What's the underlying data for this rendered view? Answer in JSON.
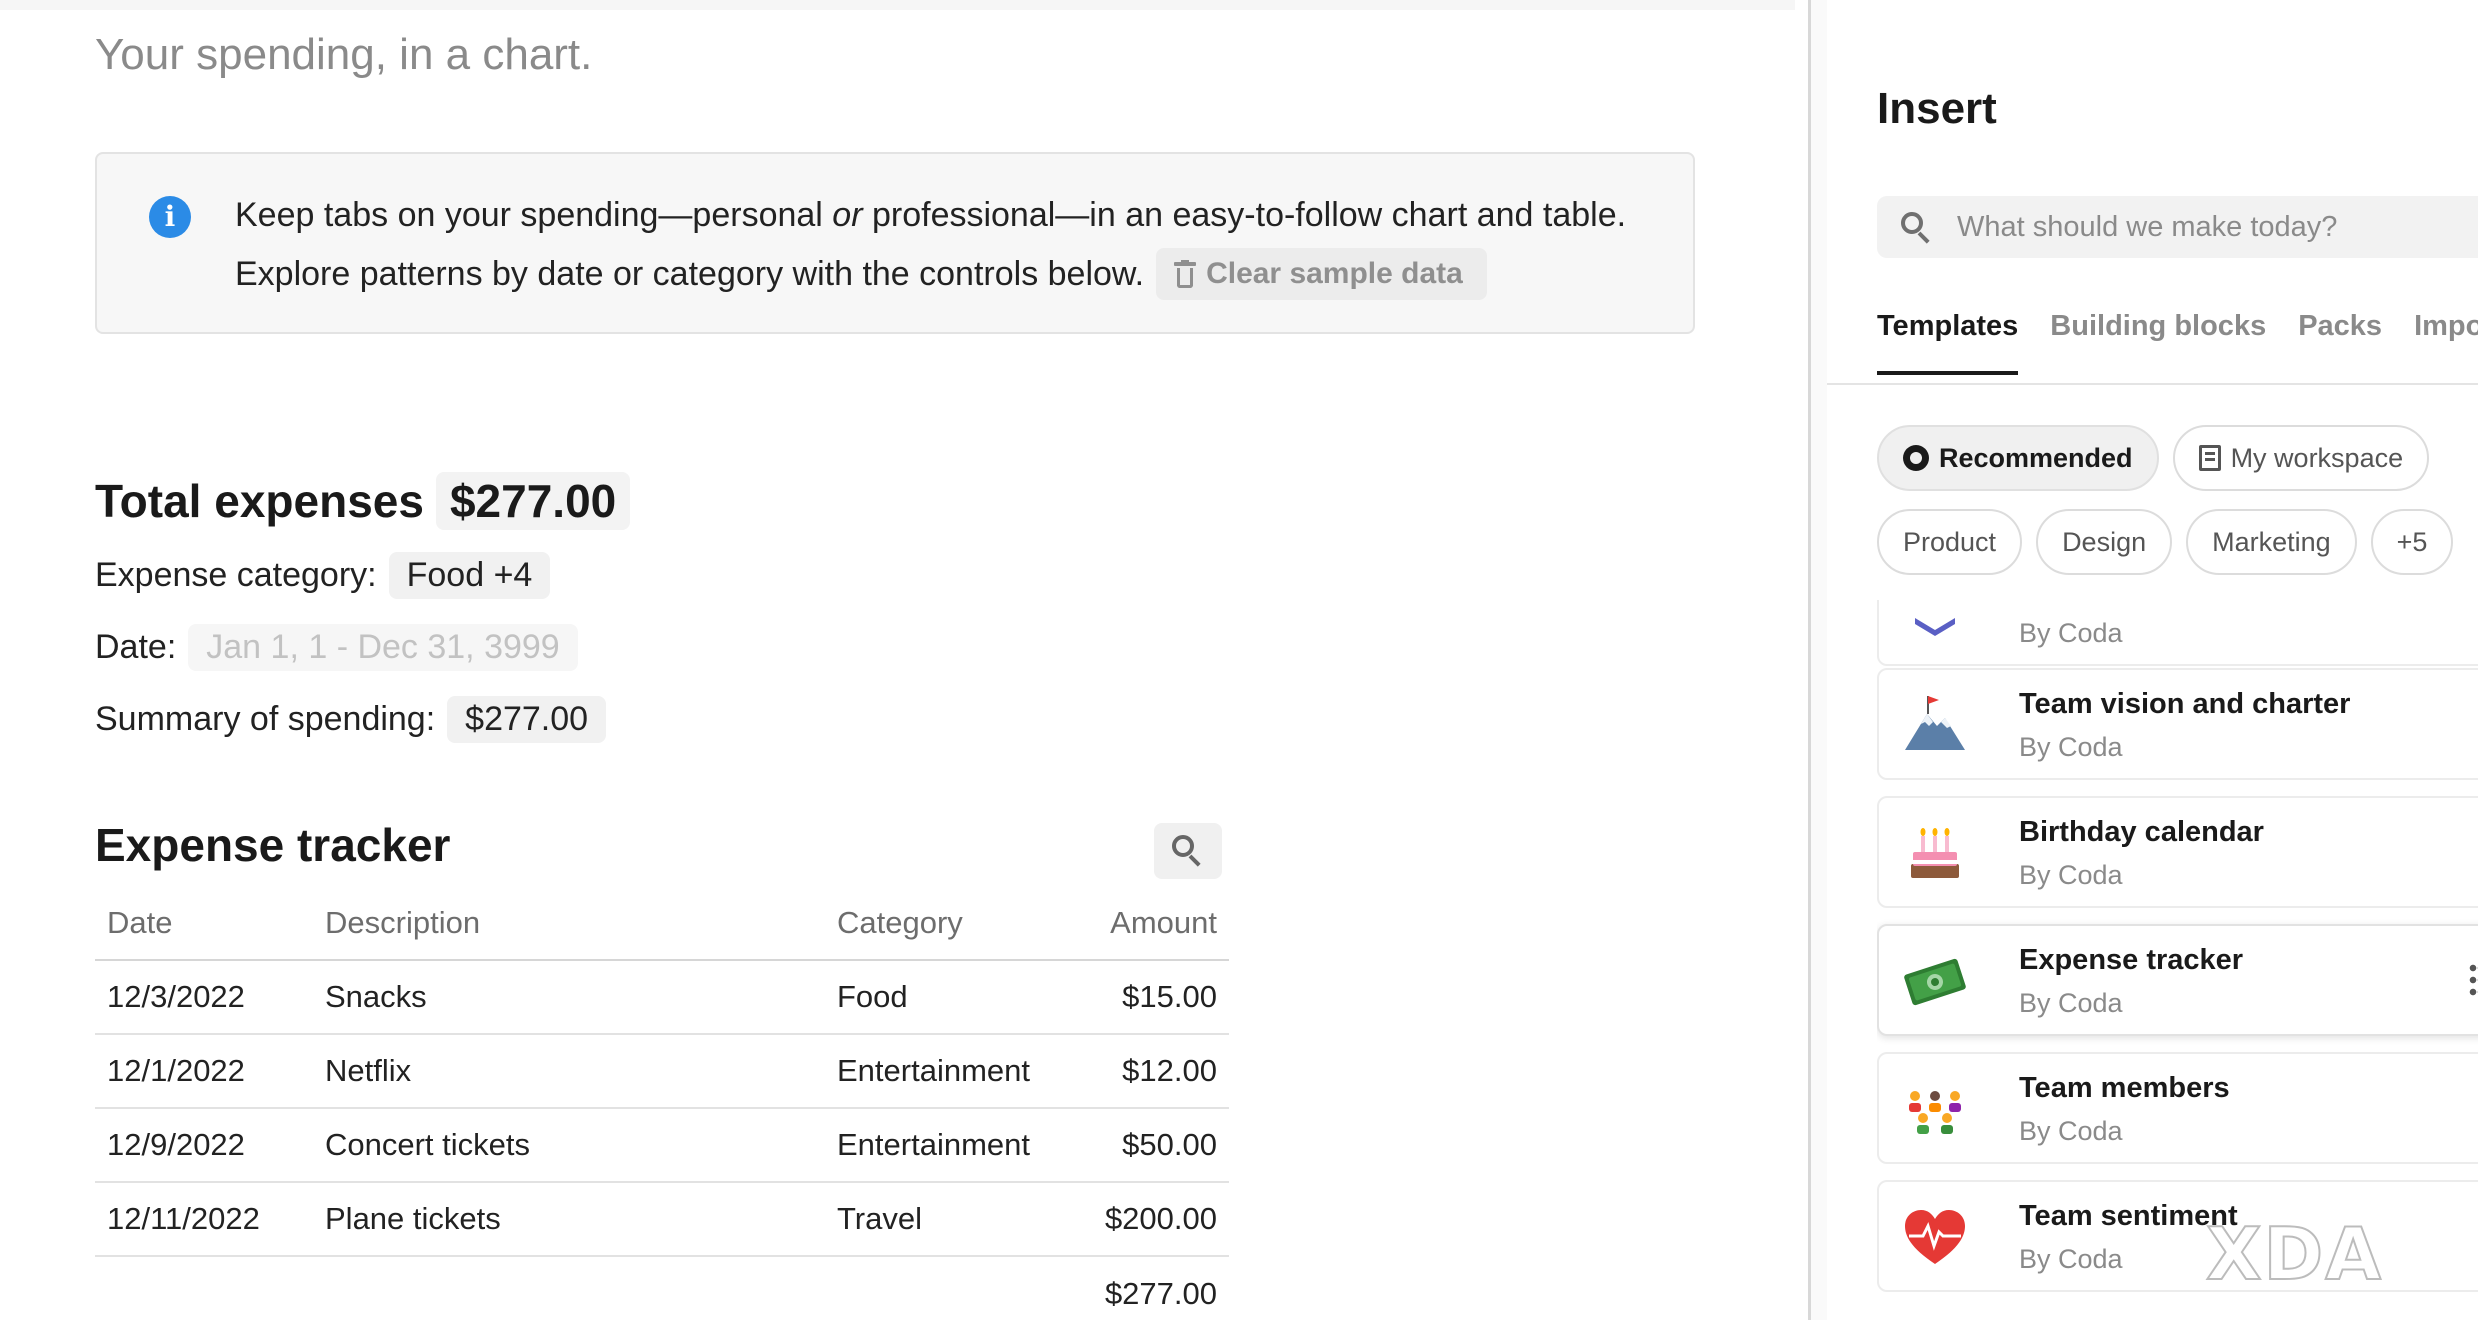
{
  "document": {
    "subtitle": "Your spending, in a chart.",
    "callout": {
      "line1_a": "Keep tabs on your spending—personal ",
      "line1_em": "or",
      "line1_b": " professional—in an easy-to-follow chart and table.",
      "line2": "Explore patterns by date or category with the controls below.",
      "clear_button": "Clear sample data"
    },
    "total": {
      "label": "Total expenses",
      "value": "$277.00"
    },
    "filters": {
      "category_label": "Expense category:",
      "category_value": "Food +4",
      "date_label": "Date:",
      "date_value": "Jan 1, 1 - Dec 31, 3999",
      "summary_label": "Summary of spending:",
      "summary_value": "$277.00"
    },
    "tracker": {
      "title": "Expense tracker",
      "columns": [
        "Date",
        "Description",
        "Category",
        "Amount"
      ],
      "rows": [
        [
          "12/3/2022",
          "Snacks",
          "Food",
          "$15.00"
        ],
        [
          "12/1/2022",
          "Netflix",
          "Entertainment",
          "$12.00"
        ],
        [
          "12/9/2022",
          "Concert tickets",
          "Entertainment",
          "$50.00"
        ],
        [
          "12/11/2022",
          "Plane tickets",
          "Travel",
          "$200.00"
        ]
      ],
      "total": "$277.00"
    }
  },
  "panel": {
    "title": "Insert",
    "search_placeholder": "What should we make today?",
    "tabs": [
      "Templates",
      "Building blocks",
      "Packs",
      "Import"
    ],
    "chips_row1": [
      "Recommended",
      "My workspace"
    ],
    "chips_row2": [
      "Product",
      "Design",
      "Marketing",
      "+5"
    ],
    "cards": [
      {
        "name": "",
        "by": "By Coda",
        "icon": "partial-icon"
      },
      {
        "name": "Team vision and charter",
        "by": "By Coda",
        "icon": "mountain-flag-icon"
      },
      {
        "name": "Birthday calendar",
        "by": "By Coda",
        "icon": "birthday-cake-icon"
      },
      {
        "name": "Expense tracker",
        "by": "By Coda",
        "icon": "money-icon"
      },
      {
        "name": "Team members",
        "by": "By Coda",
        "icon": "people-icon"
      },
      {
        "name": "Team sentiment",
        "by": "By Coda",
        "icon": "heart-pulse-icon"
      }
    ]
  },
  "watermark": "XDA"
}
